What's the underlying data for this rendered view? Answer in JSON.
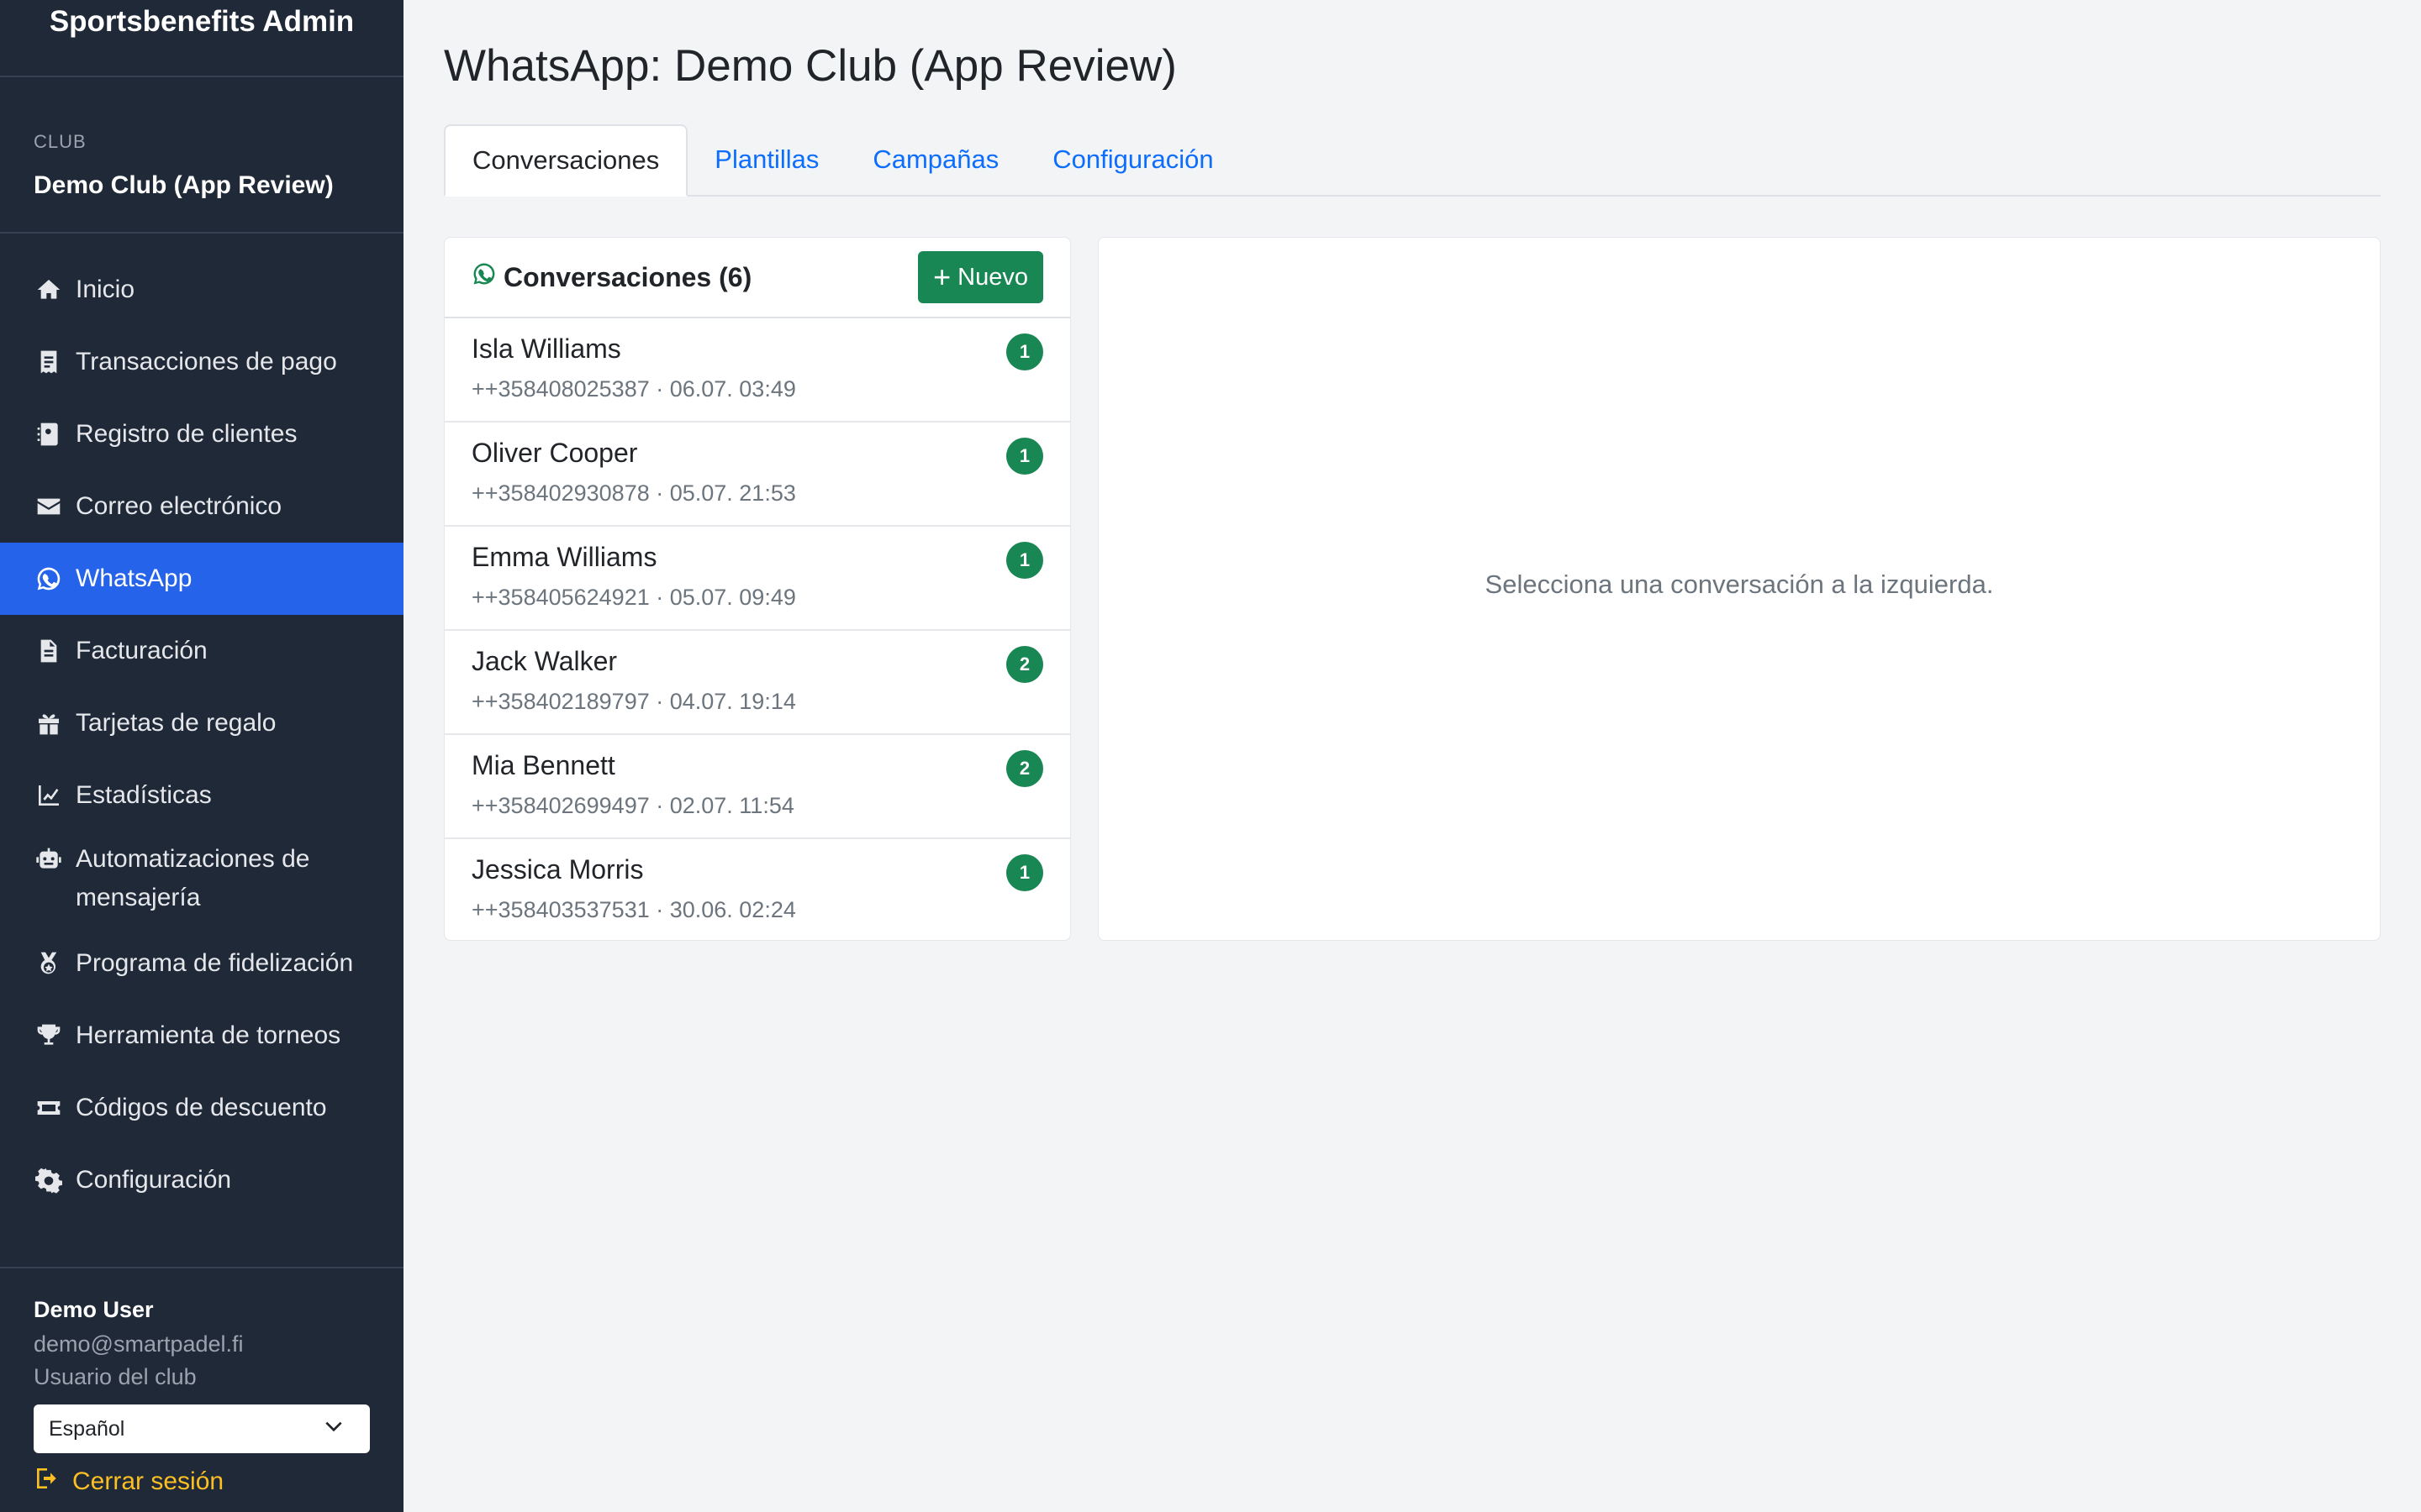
{
  "app": {
    "title": "Sportsbenefits Admin"
  },
  "club": {
    "label": "CLUB",
    "name": "Demo Club (App Review)"
  },
  "nav": {
    "items": [
      {
        "label": "Inicio",
        "icon": "home-icon"
      },
      {
        "label": "Transacciones de pago",
        "icon": "receipt-icon"
      },
      {
        "label": "Registro de clientes",
        "icon": "contact-book-icon"
      },
      {
        "label": "Correo electrónico",
        "icon": "envelope-icon"
      },
      {
        "label": "WhatsApp",
        "icon": "whatsapp-icon",
        "active": true
      },
      {
        "label": "Facturación",
        "icon": "document-icon"
      },
      {
        "label": "Tarjetas de regalo",
        "icon": "gift-icon"
      },
      {
        "label": "Estadísticas",
        "icon": "line-chart-icon"
      },
      {
        "label": "Automatizaciones de mensajería",
        "icon": "robot-icon"
      },
      {
        "label": "Programa de fidelización",
        "icon": "medal-icon"
      },
      {
        "label": "Herramienta de torneos",
        "icon": "trophy-icon"
      },
      {
        "label": "Códigos de descuento",
        "icon": "ticket-icon"
      },
      {
        "label": "Configuración",
        "icon": "gear-icon"
      }
    ]
  },
  "user": {
    "name": "Demo User",
    "email": "demo@smartpadel.fi",
    "role": "Usuario del club",
    "language": "Español",
    "logout_label": "Cerrar sesión"
  },
  "main": {
    "title": "WhatsApp: Demo Club (App Review)",
    "tabs": [
      {
        "label": "Conversaciones",
        "active": true
      },
      {
        "label": "Plantillas"
      },
      {
        "label": "Campañas"
      },
      {
        "label": "Configuración"
      }
    ],
    "conversations_title": "Conversaciones (6)",
    "new_button": "Nuevo",
    "conversations": [
      {
        "name": "Isla Williams",
        "meta": "++358408025387 · 06.07. 03:49",
        "unread": "1"
      },
      {
        "name": "Oliver Cooper",
        "meta": "++358402930878 · 05.07. 21:53",
        "unread": "1"
      },
      {
        "name": "Emma Williams",
        "meta": "++358405624921 · 05.07. 09:49",
        "unread": "1"
      },
      {
        "name": "Jack Walker",
        "meta": "++358402189797 · 04.07. 19:14",
        "unread": "2"
      },
      {
        "name": "Mia Bennett",
        "meta": "++358402699497 · 02.07. 11:54",
        "unread": "2"
      },
      {
        "name": "Jessica Morris",
        "meta": "++358403537531 · 30.06. 02:24",
        "unread": "1"
      }
    ],
    "empty_detail": "Selecciona una conversación a la izquierda."
  },
  "colors": {
    "sidebar_bg": "#1f2937",
    "active_nav": "#2563eb",
    "whatsapp_green": "#198754",
    "link_blue": "#0d6efd",
    "logout_yellow": "#fbbf24"
  }
}
